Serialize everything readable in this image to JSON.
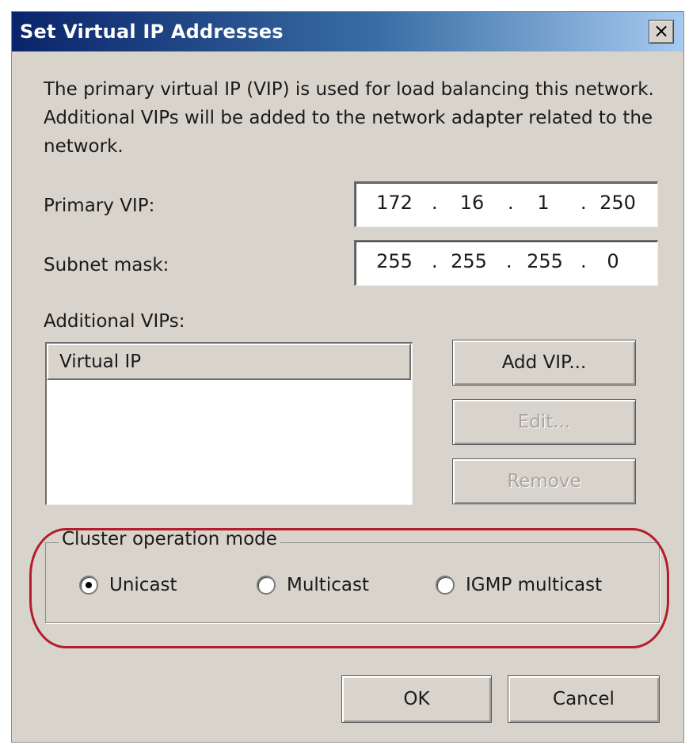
{
  "dialog": {
    "title": "Set Virtual IP Addresses",
    "close_glyph": "×",
    "description": "The primary virtual IP (VIP) is used for load balancing this network. Additional VIPs will be added to the network adapter related to the network."
  },
  "primary_vip": {
    "label": "Primary VIP:",
    "octets": [
      "172",
      "16",
      "1",
      "250"
    ]
  },
  "subnet_mask": {
    "label": "Subnet mask:",
    "octets": [
      "255",
      "255",
      "255",
      "0"
    ]
  },
  "ip_separator": ".",
  "additional_vips": {
    "label": "Additional VIPs:",
    "column_header": "Virtual IP",
    "rows": []
  },
  "buttons": {
    "add_vip": "Add VIP...",
    "edit": "Edit...",
    "remove": "Remove",
    "ok": "OK",
    "cancel": "Cancel"
  },
  "cluster_mode": {
    "legend": "Cluster operation mode",
    "options": [
      {
        "label": "Unicast",
        "selected": true
      },
      {
        "label": "Multicast",
        "selected": false
      },
      {
        "label": "IGMP multicast",
        "selected": false
      }
    ]
  },
  "colors": {
    "highlight_ring": "#b31d2c",
    "title_bar_start": "#0a246a",
    "dialog_bg": "#d8d4cc"
  }
}
